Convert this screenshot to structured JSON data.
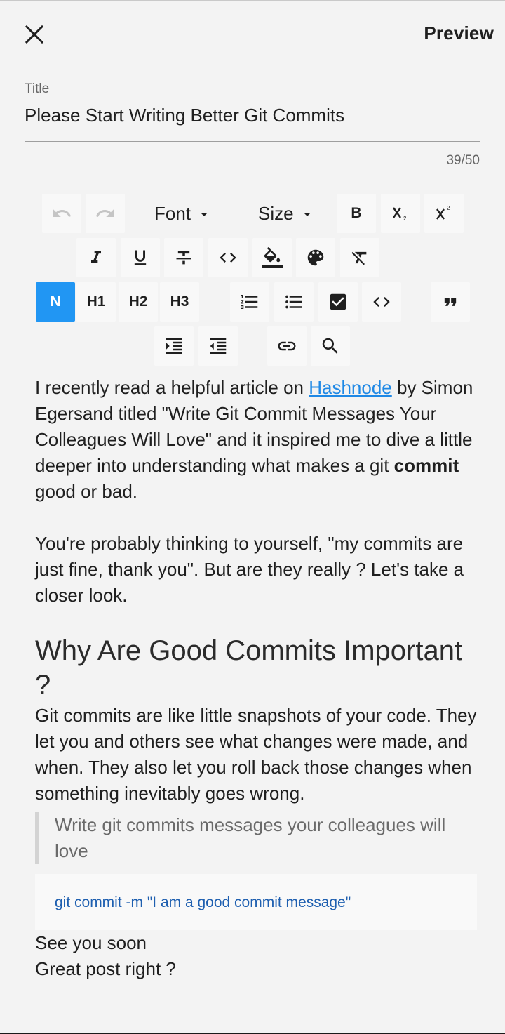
{
  "appbar": {
    "close_icon": "close-icon",
    "preview_label": "Preview"
  },
  "title_field": {
    "label": "Title",
    "value": "Please Start Writing Better Git Commits",
    "counter": "39/50"
  },
  "toolbar": {
    "font_label": "Font",
    "size_label": "Size",
    "bold": "B",
    "normal": "N",
    "h1": "H1",
    "h2": "H2",
    "h3": "H3",
    "active_color": "#2196f3"
  },
  "editor": {
    "p1_before_link": "I recently read a helpful article on ",
    "p1_link": "Hashnode",
    "p1_after_link": " by Simon Egersand titled \"Write Git Commit Messages Your Colleagues Will Love\" and it inspired me to dive a little deeper into understanding what makes a git ",
    "p1_bold": "commit",
    "p1_end": " good or bad.",
    "p2": "You're probably thinking to yourself, \"my commits are just fine, thank you\". But are they really ? Let's take a closer look.",
    "heading": "Why Are Good Commits Important ?",
    "p3": "Git commits are like little snapshots of your code. They let you and others see what changes were made, and when. They also let you roll back those changes when something inevitably goes wrong.",
    "quote": "Write git commits messages your colleagues will love",
    "code": "git commit -m \"I am a good commit message\"",
    "line_see_you": "See you soon",
    "line_great": "Great post right ?"
  },
  "colors": {
    "link": "#1e88e5",
    "code": "#1e5fb0",
    "background": "#f3f3f3"
  }
}
